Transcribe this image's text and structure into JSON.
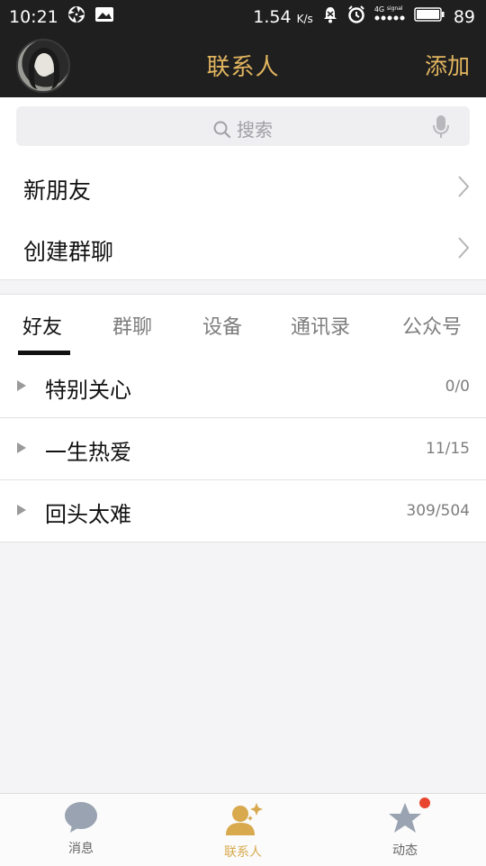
{
  "status_bar": {
    "time": "10:21",
    "speed": "1.54",
    "speed_unit": "K/s",
    "network": "4G",
    "signal_label": "signal",
    "battery": "89"
  },
  "header": {
    "title": "联系人",
    "add_label": "添加"
  },
  "search": {
    "placeholder": "搜索"
  },
  "entries": [
    {
      "label": "新朋友"
    },
    {
      "label": "创建群聊"
    }
  ],
  "tabs": [
    {
      "label": "好友",
      "active": true
    },
    {
      "label": "群聊",
      "active": false
    },
    {
      "label": "设备",
      "active": false
    },
    {
      "label": "通讯录",
      "active": false
    },
    {
      "label": "公众号",
      "active": false
    }
  ],
  "friend_groups": [
    {
      "name": "特别关心",
      "count": "0/0"
    },
    {
      "name": "一生热爱",
      "count": "11/15"
    },
    {
      "name": "回头太难",
      "count": "309/504"
    }
  ],
  "bottom_nav": [
    {
      "label": "消息",
      "icon": "chat-bubble-icon",
      "active": false
    },
    {
      "label": "联系人",
      "icon": "contact-person-icon",
      "active": true
    },
    {
      "label": "动态",
      "icon": "star-icon",
      "active": false
    }
  ],
  "colors": {
    "accent": "#e2b55f",
    "dark_bar": "#1f1f1f",
    "badge": "#e8452f"
  }
}
